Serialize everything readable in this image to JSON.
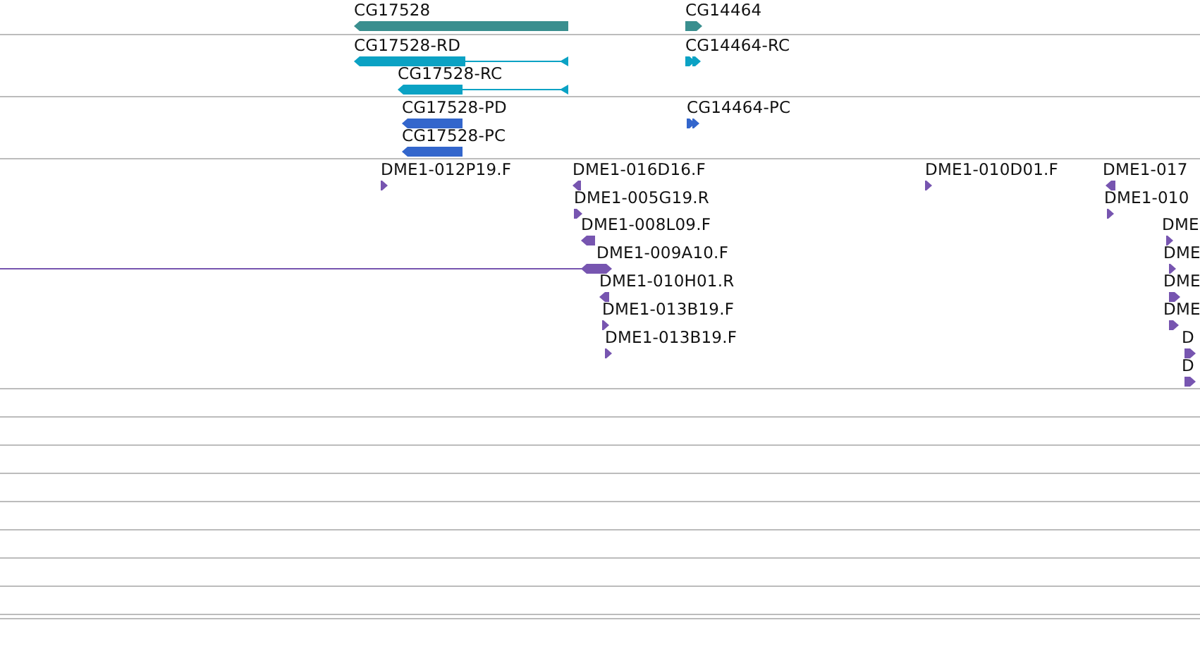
{
  "tracks": [
    {
      "color": "#3a8f8f",
      "features": [
        {
          "label": "CG17528",
          "kind": "gene",
          "reverse": true
        },
        {
          "label": "CG14464",
          "kind": "gene",
          "reverse": false
        }
      ]
    },
    {
      "color": "#0ba2c4",
      "features": [
        {
          "label": "CG17528-RD",
          "kind": "transcript",
          "reverse": true
        },
        {
          "label": "CG17528-RC",
          "kind": "transcript",
          "reverse": true
        },
        {
          "label": "CG14464-RC",
          "kind": "exon-pair",
          "reverse": false
        }
      ]
    },
    {
      "color": "#3366cc",
      "features": [
        {
          "label": "CG17528-PD",
          "kind": "protein",
          "reverse": true
        },
        {
          "label": "CG17528-PC",
          "kind": "protein",
          "reverse": true
        },
        {
          "label": "CG14464-PC",
          "kind": "exon-pair",
          "reverse": false
        }
      ]
    },
    {
      "color": "#7755b0",
      "features": [
        {
          "label": "DME1-012P19.F",
          "kind": "est",
          "reverse": false
        },
        {
          "label": "DME1-016D16.F",
          "kind": "est",
          "reverse": true
        },
        {
          "label": "DME1-005G19.R",
          "kind": "est",
          "reverse": false
        },
        {
          "label": "DME1-008L09.F",
          "kind": "est",
          "reverse": true
        },
        {
          "label": "DME1-009A10.F",
          "kind": "est-spliced",
          "reverse": true
        },
        {
          "label": "DME1-010H01.R",
          "kind": "est",
          "reverse": true
        },
        {
          "label": "DME1-013B19.F",
          "kind": "est",
          "reverse": false
        },
        {
          "label": "DME1-013B19.F",
          "kind": "est",
          "reverse": false
        },
        {
          "label": "DME1-010D01.F",
          "kind": "est",
          "reverse": false
        },
        {
          "label": "DME1-017",
          "kind": "est",
          "reverse": true
        },
        {
          "label": "DME1-010",
          "kind": "est",
          "reverse": false
        },
        {
          "label": "DME",
          "kind": "est",
          "reverse": false
        },
        {
          "label": "DME",
          "kind": "est",
          "reverse": false
        },
        {
          "label": "DME",
          "kind": "est",
          "reverse": false
        },
        {
          "label": "DME",
          "kind": "est",
          "reverse": false
        },
        {
          "label": "D",
          "kind": "est",
          "reverse": false
        },
        {
          "label": "D",
          "kind": "est",
          "reverse": false
        }
      ]
    }
  ]
}
